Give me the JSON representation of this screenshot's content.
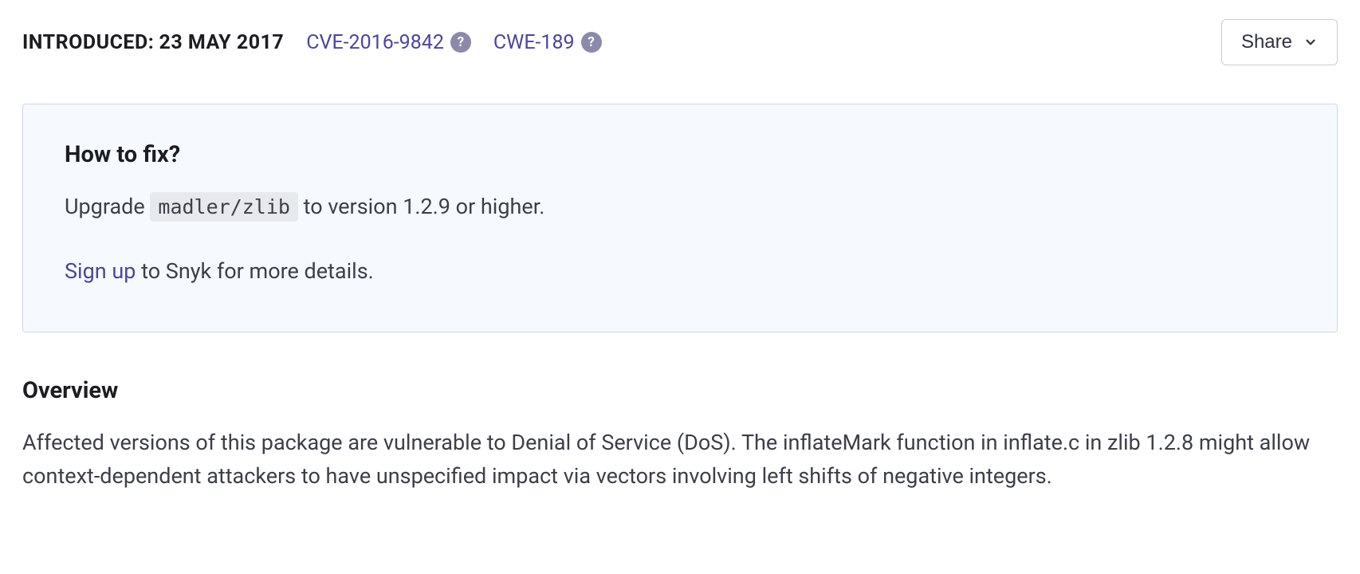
{
  "meta": {
    "introduced_label": "INTRODUCED:",
    "introduced_date": "23 MAY 2017",
    "cve": "CVE-2016-9842",
    "cwe": "CWE-189"
  },
  "share_label": "Share",
  "fix": {
    "title": "How to fix?",
    "upgrade_pre": "Upgrade ",
    "package": "madler/zlib",
    "upgrade_post": " to version 1.2.9 or higher.",
    "signup_link": "Sign up",
    "signup_rest": " to Snyk for more details."
  },
  "overview": {
    "title": "Overview",
    "text": "Affected versions of this package are vulnerable to Denial of Service (DoS). The inflateMark function in inflate.c in zlib 1.2.8 might allow context-dependent attackers to have unspecified impact via vectors involving left shifts of negative integers."
  }
}
